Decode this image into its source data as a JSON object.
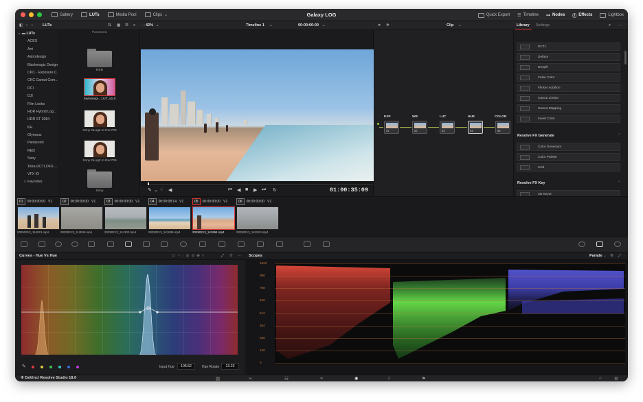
{
  "window": {
    "project_title": "Galaxy LOG",
    "traffic_lights": [
      "#fe5f57",
      "#febc2e",
      "#28c840"
    ]
  },
  "topbar": {
    "left_items": [
      {
        "label": "Gallery",
        "icon": "gallery-icon"
      },
      {
        "label": "LUTs",
        "icon": "luts-icon",
        "active": true
      },
      {
        "label": "Media Pool",
        "icon": "media-pool-icon"
      },
      {
        "label": "Clips",
        "icon": "clips-icon"
      }
    ],
    "right_items": [
      {
        "label": "Quick Export",
        "icon": "quick-export-icon"
      },
      {
        "label": "Timeline",
        "icon": "timeline-icon"
      },
      {
        "label": "Nodes",
        "icon": "nodes-icon",
        "active": true
      },
      {
        "label": "Effects",
        "icon": "effects-icon",
        "active": true
      },
      {
        "label": "Lightbox",
        "icon": "lightbox-icon"
      }
    ]
  },
  "toolbar2": {
    "luts_label": "LUTs",
    "zoom": "42%",
    "timeline": "Timeline 1",
    "timecode": "00:00:00:00",
    "clip_mode": "Clip",
    "library_tab": "Library",
    "settings_tab": "Settings"
  },
  "lut_tree": {
    "root": "LUTs",
    "items": [
      "ACES",
      "Arri",
      "Astrodesign",
      "Blackmagic Design",
      "CKC - Exposure C...",
      "CKC Gamut Com...",
      "DCI",
      "DJI",
      "Film Looks",
      "HDR Hybrid Log...",
      "HDR ST 2084",
      "KH",
      "Olympus",
      "Panasonic",
      "RED",
      "Sony",
      "Tetra-DCTLOFX-...",
      "VFX IO"
    ],
    "favorites": "Favorites"
  },
  "lut_grid": {
    "top_label": "Panasonic",
    "cells": [
      {
        "type": "folder",
        "label": "RED"
      },
      {
        "type": "face",
        "label": "Samsung-...LUT_v1.0",
        "selected": true
      },
      {
        "type": "face",
        "label": "Sony SLog2 to Rec709"
      },
      {
        "type": "face",
        "label": "Sony SLog3 to Rec709"
      },
      {
        "type": "folder",
        "label": "Sony"
      }
    ]
  },
  "viewer": {
    "timecode": "01:00:35:09"
  },
  "nodes": [
    {
      "label": "EXP",
      "num": "01"
    },
    {
      "label": "WB",
      "num": "02"
    },
    {
      "label": "LUT",
      "num": "03"
    },
    {
      "label": "HUE",
      "num": "04"
    },
    {
      "label": "COLOR",
      "num": "05"
    }
  ],
  "library": {
    "items_top": [
      "DCTL",
      "Defaze",
      "Despill",
      "False Color",
      "Flicker Addition",
      "Gamut Limiter",
      "Gamut Mapping",
      "Invert Color"
    ],
    "section_generate": "Resolve FX Generate",
    "items_generate": [
      "Color Generator",
      "Color Palette",
      "Grid"
    ],
    "section_key": "Resolve FX Key",
    "items_key": [
      "3D Keyer"
    ]
  },
  "clips": [
    {
      "num": "01",
      "tc": "00:00:00:00",
      "track": "V1",
      "name": "20250213_114021.mp4",
      "scene": "beach-people"
    },
    {
      "num": "02",
      "tc": "00:00:00:00",
      "track": "V1",
      "name": "20250213_114045.mp4",
      "scene": "grey-city"
    },
    {
      "num": "03",
      "tc": "00:00:00:00",
      "track": "V1",
      "name": "20250213_114102.mp4",
      "scene": "grey-sea"
    },
    {
      "num": "04",
      "tc": "00:00:08:14",
      "track": "V1",
      "name": "20250213_141836.mp4",
      "scene": "blue-beach"
    },
    {
      "num": "05",
      "tc": "00:00:00:00",
      "track": "V1",
      "name": "20250213_141854.mp4",
      "scene": "warm-beach",
      "active": true
    },
    {
      "num": "06",
      "tc": "00:00:00:00",
      "track": "V1",
      "name": "20250213_141910.mp4",
      "scene": "grey-shore"
    }
  ],
  "curves": {
    "title": "Curves - Hue Vs Hue",
    "input_hue_label": "Input Hue",
    "input_hue_value": "106.52",
    "hue_rotate_label": "Hue Rotate",
    "hue_rotate_value": "13.23",
    "swatches": [
      "#e03a3a",
      "#e0c93a",
      "#3ac24a",
      "#3ac2c2",
      "#3a6ae0",
      "#c23ae0"
    ]
  },
  "scopes": {
    "title": "Scopes",
    "mode": "Parade",
    "y_ticks": [
      "1023",
      "896",
      "768",
      "640",
      "512",
      "384",
      "256",
      "128",
      "0"
    ]
  },
  "pagebar": {
    "app_name": "DaVinci Resolve Studio 18.6"
  }
}
